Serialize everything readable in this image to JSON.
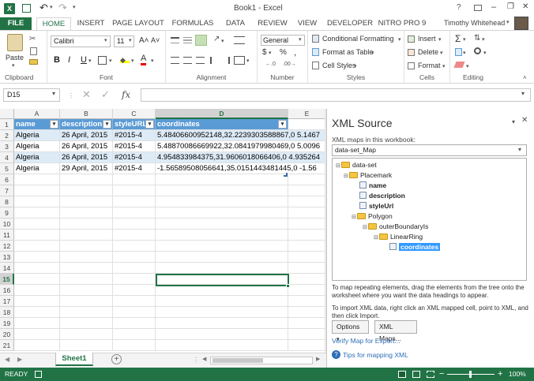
{
  "window": {
    "title": "Book1 - Excel",
    "help": "?",
    "min": "–",
    "max": "❐",
    "close": "✕"
  },
  "qat": {
    "save": "💾",
    "undo": "↶",
    "redo": "↷"
  },
  "tabs": [
    "FILE",
    "HOME",
    "INSERT",
    "PAGE LAYOUT",
    "FORMULAS",
    "DATA",
    "REVIEW",
    "VIEW",
    "DEVELOPER",
    "NITRO PRO 9"
  ],
  "user": "Timothy Whitehead",
  "ribbon": {
    "clipboard": {
      "paste": "Paste",
      "label": "Clipboard"
    },
    "font": {
      "name": "Calibri",
      "size": "11",
      "bold": "B",
      "italic": "I",
      "underline": "U",
      "grow": "A˄",
      "shrink": "A˅",
      "label": "Font"
    },
    "alignment": {
      "label": "Alignment"
    },
    "number": {
      "format": "General",
      "currency": "$",
      "percent": "%",
      "comma": ",",
      "label": "Number"
    },
    "styles": {
      "cond": "Conditional Formatting",
      "table": "Format as Table",
      "cell": "Cell Styles",
      "label": "Styles"
    },
    "cells": {
      "insert": "Insert",
      "delete": "Delete",
      "format": "Format",
      "label": "Cells"
    },
    "editing": {
      "sum": "Σ",
      "label": "Editing"
    }
  },
  "formula_bar": {
    "name_box": "D15",
    "fx": "fx",
    "value": ""
  },
  "columns": [
    "A",
    "B",
    "C",
    "D",
    "E"
  ],
  "row_numbers": [
    "1",
    "2",
    "3",
    "4",
    "5",
    "6",
    "7",
    "8",
    "9",
    "10",
    "11",
    "12",
    "13",
    "14",
    "15",
    "16",
    "17",
    "18",
    "19",
    "20",
    "21"
  ],
  "table": {
    "headers": [
      "name",
      "description",
      "styleURL",
      "coordinates"
    ],
    "rows": [
      [
        "Algeria",
        "26 April, 2015",
        "#2015-4",
        "5.48406600952148,32.2239303588867,0 5.1467"
      ],
      [
        "Algeria",
        "26 April, 2015",
        "#2015-4",
        "5.48870086669922,32.0841979980469,0 5.0096"
      ],
      [
        "Algeria",
        "26 April, 2015",
        "#2015-4",
        "4.954833984375,31.9606018066406,0 4.935264"
      ],
      [
        "Algeria",
        "29 April, 2015",
        "#2015-4",
        "-1.56589508056641,35.0151443481445,0 -1.56"
      ]
    ]
  },
  "sheet_tabs": [
    "Sheet1"
  ],
  "status": {
    "ready": "READY",
    "zoom": "100%"
  },
  "xml_pane": {
    "title": "XML Source",
    "maps_label": "XML maps in this workbook:",
    "selected_map": "data-set_Map",
    "tree": {
      "root": "data-set",
      "placemark": "Placemark",
      "name": "name",
      "description": "description",
      "styleUrl": "styleUrl",
      "polygon": "Polygon",
      "outer": "outerBoundaryIs",
      "ring": "LinearRing",
      "coords": "coordinates"
    },
    "help1": "To map repeating elements, drag the elements from the tree onto the worksheet where you want the data headings to appear.",
    "help2": "To import XML data, right click an XML mapped cell, point to XML, and then click Import.",
    "options": "Options",
    "xml_maps": "XML Maps...",
    "verify": "Verify Map for Export...",
    "tips": "Tips for mapping XML"
  }
}
